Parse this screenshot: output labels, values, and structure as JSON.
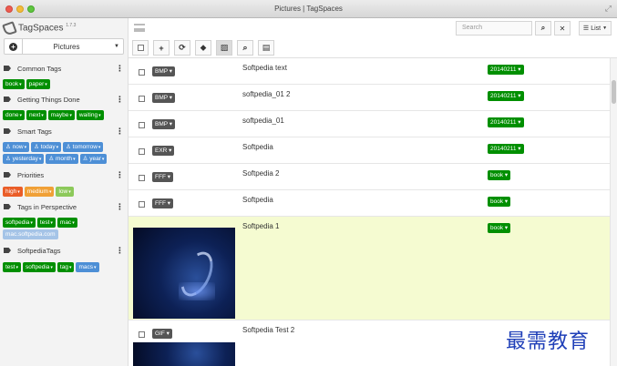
{
  "window": {
    "title": "Pictures | TagSpaces"
  },
  "app": {
    "name": "TagSpaces",
    "version": "1.7.3"
  },
  "location": {
    "name": "Pictures"
  },
  "search": {
    "placeholder": "Search"
  },
  "view_mode": {
    "label": "List"
  },
  "tag_groups": [
    {
      "title": "Common Tags",
      "tags": [
        {
          "label": "book",
          "color": "#008f00"
        },
        {
          "label": "paper",
          "color": "#008f00"
        }
      ]
    },
    {
      "title": "Getting Things Done",
      "tags": [
        {
          "label": "done",
          "color": "#008f00"
        },
        {
          "label": "next",
          "color": "#008f00"
        },
        {
          "label": "maybe",
          "color": "#008f00"
        },
        {
          "label": "waiting",
          "color": "#008f00"
        }
      ]
    },
    {
      "title": "Smart Tags",
      "tags": [
        {
          "label": "now",
          "color": "#4d8fd6"
        },
        {
          "label": "today",
          "color": "#4d8fd6"
        },
        {
          "label": "tomorrow",
          "color": "#4d8fd6"
        },
        {
          "label": "yesterday",
          "color": "#4d8fd6"
        },
        {
          "label": "month",
          "color": "#4d8fd6"
        },
        {
          "label": "year",
          "color": "#4d8fd6"
        }
      ]
    },
    {
      "title": "Priorities",
      "tags": [
        {
          "label": "high",
          "color": "#ea5d28"
        },
        {
          "label": "medium",
          "color": "#f0a036"
        },
        {
          "label": "low",
          "color": "#8cc95a"
        }
      ]
    },
    {
      "title": "Tags in Perspective",
      "tags": [
        {
          "label": "softpedia",
          "color": "#008f00"
        },
        {
          "label": "test",
          "color": "#008f00"
        },
        {
          "label": "mac",
          "color": "#008f00"
        },
        {
          "label": "mac.softpedia.com",
          "color": "#a5c4e7"
        }
      ]
    },
    {
      "title": "SoftpediaTags",
      "tags": [
        {
          "label": "test",
          "color": "#008f00"
        },
        {
          "label": "softpedia",
          "color": "#008f00"
        },
        {
          "label": "tag",
          "color": "#008f00"
        },
        {
          "label": "macs",
          "color": "#4d8fd6"
        }
      ]
    }
  ],
  "files": [
    {
      "ext": "BMP",
      "name": "Softpedia text",
      "tag": "20140211"
    },
    {
      "ext": "BMP",
      "name": "softpedia_01 2",
      "tag": "20140211"
    },
    {
      "ext": "BMP",
      "name": "softpedia_01",
      "tag": "20140211"
    },
    {
      "ext": "EXR",
      "name": "Softpedia",
      "tag": "20140211"
    },
    {
      "ext": "FFF",
      "name": "Softpedia 2",
      "tag": "book"
    },
    {
      "ext": "FFF",
      "name": "Softpedia",
      "tag": "book"
    },
    {
      "ext": "",
      "name": "Softpedia 1",
      "tag": "book"
    },
    {
      "ext": "GIF",
      "name": "Softpedia Test 2",
      "tag": ""
    }
  ],
  "watermark": {
    "text": "最需教育"
  }
}
